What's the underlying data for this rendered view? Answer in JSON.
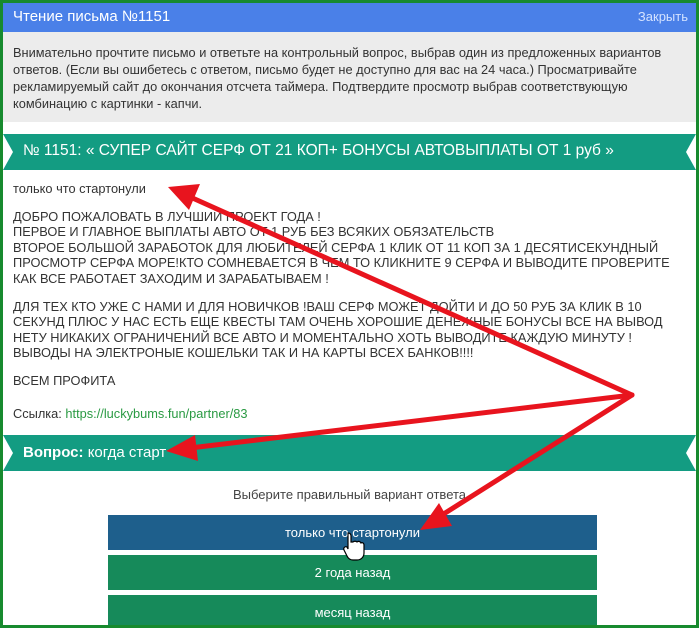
{
  "window": {
    "title": "Чтение письма №1151",
    "close_label": "Закрыть"
  },
  "notice": {
    "text": "Внимательно прочтите письмо и ответьте на контрольный вопрос, выбрав один из предложенных вариантов ответов. (Если вы ошибетесь с ответом, письмо будет не доступно для вас на 24 часа.) Просматривайте рекламируемый сайт до окончания отсчета таймера. Подтвердите просмотр выбрав соответствующую комбинацию с картинки - капчи."
  },
  "letter": {
    "subject": "№ 1151: « СУПЕР САЙТ СЕРФ ОТ 21 КОП+ БОНУСЫ АВТОВЫПЛАТЫ ОТ 1 руб »",
    "lines": [
      "только что стартонули",
      "",
      "ДОБРО ПОЖАЛОВАТЬ В ЛУЧШИЙ ПРОЕКТ ГОДА !",
      "ПЕРВОЕ И ГЛАВНОЕ ВЫПЛАТЫ АВТО ОТ 1 РУБ БЕЗ ВСЯКИХ ОБЯЗАТЕЛЬСТВ",
      "ВТОРОЕ БОЛЬШОЙ ЗАРАБОТОК ДЛЯ ЛЮБИТЕЛЕЙ СЕРФА 1 КЛИК ОТ 11 КОП ЗА 1 ДЕСЯТИСЕКУНДНЫЙ",
      "ПРОСМОТР СЕРФА МОРЕ!КТО СОМНЕВАЕТСЯ В ЧЕМ ТО КЛИКНИТЕ 9 СЕРФА И ВЫВОДИТЕ ПРОВЕРИТЕ",
      "КАК ВСЕ РАБОТАЕТ ЗАХОДИМ И ЗАРАБАТЫВАЕМ !",
      "",
      "ДЛЯ ТЕХ КТО УЖЕ С НАМИ И ДЛЯ НОВИЧКОВ !ВАШ СЕРФ МОЖЕТ ДОЙТИ И ДО 50 РУБ ЗА КЛИК В 10",
      "СЕКУНД ПЛЮС У НАС ЕСТЬ ЕЩЕ КВЕСТЫ ТАМ ОЧЕНЬ ХОРОШИЕ ДЕНЕЖНЫЕ БОНУСЫ ВСЕ НА ВЫВОД",
      "НЕТУ НИКАКИХ ОГРАНИЧЕНИЙ ВСЕ АВТО И МОМЕНТАЛЬНО ХОТЬ ВЫВОДИТЕ КАЖДУЮ МИНУТУ !",
      "ВЫВОДЫ НА ЭЛЕКТРОНЫЕ КОШЕЛЬКИ ТАК И НА КАРТЫ ВСЕХ БАНКОВ!!!!",
      "",
      "ВСЕМ ПРОФИТА"
    ],
    "link_label": "Ссылка:",
    "link_url": "https://luckybums.fun/partner/83"
  },
  "question": {
    "label": "Вопрос:",
    "text": "когда старт"
  },
  "answers": {
    "prompt": "Выберите правильный вариант ответа",
    "options": [
      "только что стартонули",
      "2 года назад",
      "месяц назад"
    ]
  },
  "colors": {
    "frame_border": "#178a2e",
    "titlebar": "#4a80e8",
    "ribbon": "#139c82",
    "answer_selected": "#1e5f8c",
    "answer": "#168a5a",
    "annotation_arrow": "#e8141e"
  },
  "icons": {
    "cursor": "hand-pointer-icon"
  }
}
